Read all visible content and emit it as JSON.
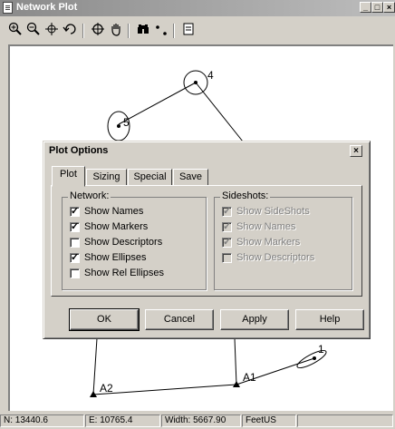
{
  "window": {
    "title": "Network Plot",
    "buttons": {
      "minimize": "_",
      "maximize": "□",
      "close": "×"
    }
  },
  "toolbar": {
    "icons": [
      "zoom-in-icon",
      "zoom-out-icon",
      "pan-icon",
      "undo-zoom-icon",
      "center-icon",
      "hand-icon",
      "find-icon",
      "points-icon",
      "options-icon"
    ]
  },
  "plot": {
    "points": [
      {
        "name": "4"
      },
      {
        "name": "5"
      },
      {
        "name": "1"
      },
      {
        "name": "A1"
      },
      {
        "name": "A2"
      }
    ]
  },
  "dialog": {
    "title": "Plot Options",
    "close": "×",
    "tabs": [
      "Plot",
      "Sizing",
      "Special",
      "Save"
    ],
    "active_tab": "Plot",
    "network": {
      "label": "Network:",
      "options": [
        {
          "label": "Show Names",
          "checked": true
        },
        {
          "label": "Show Markers",
          "checked": true
        },
        {
          "label": "Show Descriptors",
          "checked": false
        },
        {
          "label": "Show Ellipses",
          "checked": true
        },
        {
          "label": "Show Rel Ellipses",
          "checked": false
        }
      ]
    },
    "sideshots": {
      "label": "Sideshots:",
      "enabled": false,
      "options": [
        {
          "label": "Show SideShots",
          "checked": true
        },
        {
          "label": "Show Names",
          "checked": true
        },
        {
          "label": "Show Markers",
          "checked": true
        },
        {
          "label": "Show Descriptors",
          "checked": false
        }
      ]
    },
    "buttons": {
      "ok": "OK",
      "cancel": "Cancel",
      "apply": "Apply",
      "help": "Help"
    }
  },
  "status": {
    "north": "N: 13440.6",
    "east": "E: 10765.4",
    "width": "Width: 5667.90",
    "units": "FeetUS"
  }
}
